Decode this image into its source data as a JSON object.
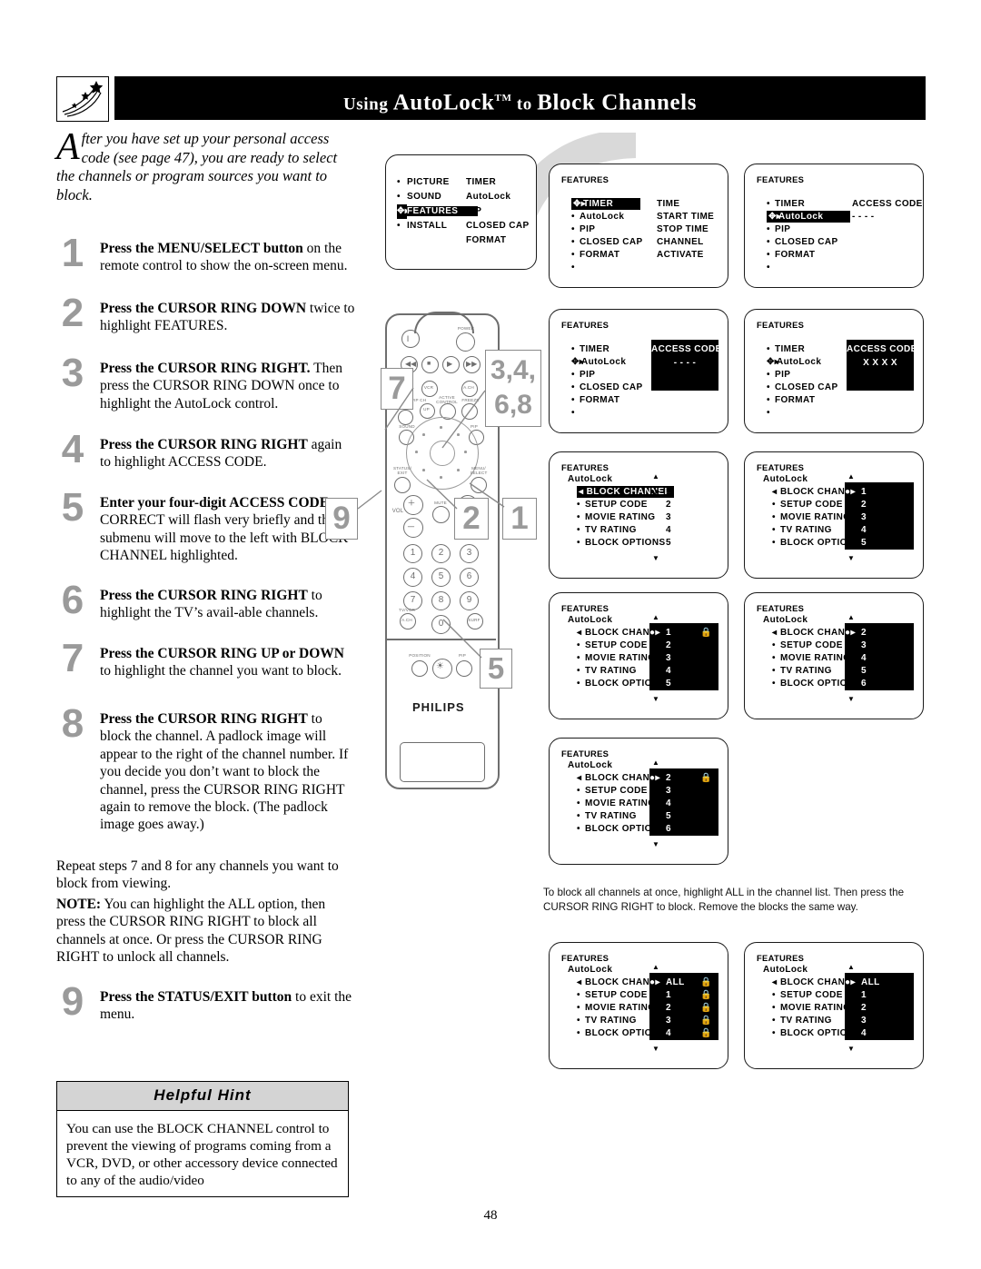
{
  "page": {
    "title_prefix": "Using ",
    "title_word1": "AutoLock",
    "title_tm": "TM",
    "title_mid": " to ",
    "title_word2": "Block ",
    "title_word3": "Channels",
    "number": "48",
    "header_icon": "star-trail-icon"
  },
  "intro": {
    "dropcap": "A",
    "text": "fter you have set up your personal access code (see page 47), you are ready to select the channels or program sources you want to block."
  },
  "steps": [
    {
      "num": "1",
      "bold": "Press the MENU/SELECT button",
      "rest": " on the remote control to show the on-screen menu."
    },
    {
      "num": "2",
      "bold": "Press the CURSOR RING DOWN",
      "rest": " twice to highlight FEATURES."
    },
    {
      "num": "3",
      "bold": "Press the CURSOR RING RIGHT.",
      "rest": " Then press the CURSOR RING DOWN once to highlight the AutoLock control."
    },
    {
      "num": "4",
      "bold": "Press the CURSOR RING RIGHT",
      "rest": " again to highlight ACCESS CODE."
    },
    {
      "num": "5",
      "bold": "Enter your four-digit ACCESS CODE.",
      "rest": " CORRECT will flash very briefly and the submenu will move to the left with BLOCK CHANNEL highlighted."
    },
    {
      "num": "6",
      "bold": "Press the CURSOR RING RIGHT",
      "rest": " to highlight the TV’s avail-able channels."
    },
    {
      "num": "7",
      "bold": "Press the CURSOR RING UP or DOWN",
      "rest": " to highlight the channel you want to block."
    },
    {
      "num": "8",
      "bold": "Press the CURSOR RING RIGHT",
      "rest": " to block the channel. A padlock image will appear to the right of the channel number. If you decide you don’t want to block the channel, press the CURSOR RING RIGHT again to remove the block. (The padlock image goes away.)"
    }
  ],
  "repeat_para": "Repeat steps 7 and 8 for any channels you want to block from viewing.",
  "note": {
    "label": "NOTE:",
    "text": " You can highlight the ALL option, then press the CURSOR RING RIGHT to block all channels at once. Or press the CURSOR RING RIGHT to unlock all channels."
  },
  "step9": {
    "num": "9",
    "bold": "Press the STATUS/EXIT button",
    "rest": " to exit the menu."
  },
  "hint": {
    "heading": "Helpful Hint",
    "body": "You can use the BLOCK CHANNEL control to prevent the viewing of programs coming from a VCR, DVD, or other accessory device connected to any of the audio/video"
  },
  "caption": "To block all channels at once, highlight ALL in the channel list. Then press the CURSOR RING RIGHT to block. Remove the blocks the same way.",
  "main_menu": {
    "left_items": [
      "PICTURE",
      "SOUND",
      "FEATURES",
      "INSTALL"
    ],
    "highlighted": "FEATURES",
    "right_items": [
      "TIMER",
      "AutoLock",
      "PIP",
      "CLOSED CAP",
      "FORMAT"
    ]
  },
  "screens": [
    {
      "id": "s1",
      "title": "FEATURES",
      "left": [
        "TIMER",
        "AutoLock",
        "PIP",
        "CLOSED CAP",
        "FORMAT",
        ""
      ],
      "highlight_index": 0,
      "right": [
        "TIME",
        "START TIME",
        "STOP TIME",
        "CHANNEL",
        "ACTIVATE"
      ],
      "right_panel_black": false
    },
    {
      "id": "s2",
      "title": "FEATURES",
      "left": [
        "TIMER",
        "AutoLock",
        "PIP",
        "CLOSED CAP",
        "FORMAT",
        ""
      ],
      "highlight_index": 1,
      "right": [
        "ACCESS CODE",
        "- - - -"
      ],
      "right_panel_black": false
    },
    {
      "id": "s3",
      "title": "FEATURES",
      "left": [
        "TIMER",
        "AutoLock",
        "PIP",
        "CLOSED CAP",
        "FORMAT",
        ""
      ],
      "highlight_index": -1,
      "cursor_index": 1,
      "right": [
        "ACCESS CODE",
        "- - - -"
      ],
      "right_panel_black": true
    },
    {
      "id": "s4",
      "title": "FEATURES",
      "left": [
        "TIMER",
        "AutoLock",
        "PIP",
        "CLOSED CAP",
        "FORMAT",
        ""
      ],
      "highlight_index": -1,
      "cursor_index": 1,
      "right": [
        "ACCESS CODE",
        "X X X X"
      ],
      "right_panel_black": true
    }
  ],
  "autolock_screens": [
    {
      "id": "a1",
      "title": "FEATURES",
      "sub": "AutoLock",
      "items": [
        "BLOCK CHANNEL",
        "SETUP CODE",
        "MOVIE RATING",
        "TV RATING",
        "BLOCK OPTIONS"
      ],
      "channels": [
        "1",
        "2",
        "3",
        "4",
        "5"
      ],
      "locks": [
        false,
        false,
        false,
        false,
        false
      ],
      "highlight_item": 0,
      "panel_black": false
    },
    {
      "id": "a2",
      "title": "FEATURES",
      "sub": "AutoLock",
      "items": [
        "BLOCK CHANNEL",
        "SETUP CODE",
        "MOVIE RATING",
        "TV RATING",
        "BLOCK OPTIONS"
      ],
      "channels": [
        "1",
        "2",
        "3",
        "4",
        "5"
      ],
      "locks": [
        false,
        false,
        false,
        false,
        false
      ],
      "highlight_item": -1,
      "panel_black": true
    },
    {
      "id": "a3",
      "title": "FEATURES",
      "sub": "AutoLock",
      "items": [
        "BLOCK CHANNEL",
        "SETUP CODE",
        "MOVIE RATING",
        "TV RATING",
        "BLOCK OPTIONS"
      ],
      "channels": [
        "1",
        "2",
        "3",
        "4",
        "5"
      ],
      "locks": [
        true,
        false,
        false,
        false,
        false
      ],
      "highlight_item": -1,
      "panel_black": true
    },
    {
      "id": "a4",
      "title": "FEATURES",
      "sub": "AutoLock",
      "items": [
        "BLOCK CHANNEL",
        "SETUP CODE",
        "MOVIE RATING",
        "TV RATING",
        "BLOCK OPTIONS"
      ],
      "channels": [
        "2",
        "3",
        "4",
        "5",
        "6"
      ],
      "locks": [
        false,
        false,
        false,
        false,
        false
      ],
      "highlight_item": -1,
      "panel_black": true
    },
    {
      "id": "a5",
      "title": "FEATURES",
      "sub": "AutoLock",
      "items": [
        "BLOCK CHANNEL",
        "SETUP CODE",
        "MOVIE RATING",
        "TV RATING",
        "BLOCK OPTIONS"
      ],
      "channels": [
        "2",
        "3",
        "4",
        "5",
        "6"
      ],
      "locks": [
        true,
        false,
        false,
        false,
        false
      ],
      "highlight_item": -1,
      "panel_black": true
    },
    {
      "id": "a6",
      "title": "FEATURES",
      "sub": "AutoLock",
      "items": [
        "BLOCK CHANNEL",
        "SETUP CODE",
        "MOVIE RATING",
        "TV RATING",
        "BLOCK OPTIONS"
      ],
      "channels": [
        "ALL",
        "1",
        "2",
        "3",
        "4"
      ],
      "locks": [
        true,
        true,
        true,
        true,
        true
      ],
      "highlight_item": -1,
      "panel_black": true
    },
    {
      "id": "a7",
      "title": "FEATURES",
      "sub": "AutoLock",
      "items": [
        "BLOCK CHANNEL",
        "SETUP CODE",
        "MOVIE RATING",
        "TV RATING",
        "BLOCK OPTIONS"
      ],
      "channels": [
        "ALL",
        "1",
        "2",
        "3",
        "4"
      ],
      "locks": [
        false,
        false,
        false,
        false,
        false
      ],
      "highlight_item": -1,
      "panel_black": true
    }
  ],
  "remote": {
    "brand": "PHILIPS",
    "labels": [
      "POWER",
      "VOL",
      "A.CH",
      "ACTIVE CONTROL",
      "FREEZE",
      "PIP CH",
      "UP",
      "SOUND",
      "PIP",
      "STATUS/ EXIT",
      "MENU/ SELECT",
      "VOL",
      "MUTE",
      "CH",
      "TV/VCR",
      "SURF",
      "POSITION",
      "PIP"
    ],
    "keypad": [
      "1",
      "2",
      "3",
      "4",
      "5",
      "6",
      "7",
      "8",
      "9",
      "0"
    ],
    "tvvcr": "A.CH",
    "surf": "SURF"
  },
  "callouts": [
    "1",
    "2",
    "3,4,\n6,8",
    "5",
    "7",
    "9"
  ]
}
